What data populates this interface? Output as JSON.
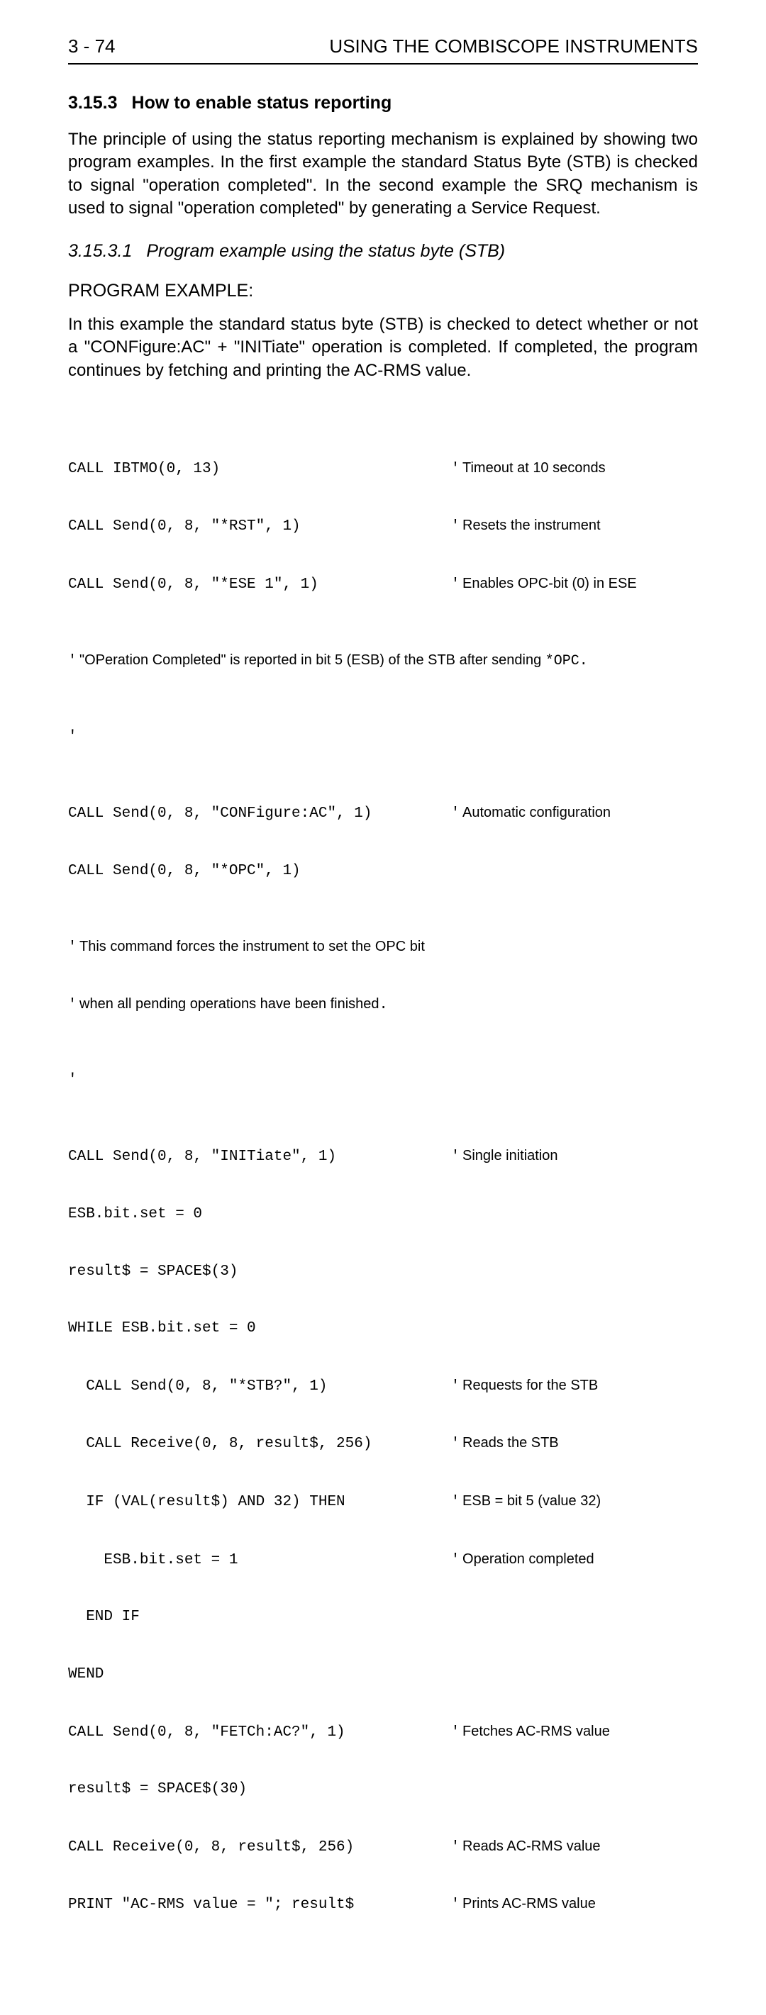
{
  "header": {
    "left": "3 - 74",
    "right": "USING THE COMBISCOPE INSTRUMENTS"
  },
  "section": {
    "number": "3.15.3",
    "title": "How to enable status reporting"
  },
  "para1": "The principle of using the status reporting mechanism is explained by showing two program examples. In the first example the standard Status Byte (STB) is checked to signal \"operation completed\". In the second example the SRQ mechanism is used to signal \"operation completed\" by generating a Service Request.",
  "subsection": {
    "number": "3.15.3.1",
    "title": "Program example using the status byte (STB)"
  },
  "programExampleLabel": "PROGRAM EXAMPLE:",
  "para2": "In this example the standard status byte (STB) is checked to detect whether or not a \"CONFigure:AC\" + \"INITiate\" operation is completed. If completed, the program continues by fetching and printing the AC-RMS value.",
  "code": {
    "l1": {
      "code": "CALL IBTMO(0, 13)",
      "comment": "Timeout at 10 seconds"
    },
    "l2": {
      "code": "CALL Send(0, 8, \"*RST\", 1)",
      "comment": "Resets the instrument"
    },
    "l3": {
      "code": "CALL Send(0, 8, \"*ESE 1\", 1)",
      "comment": "Enables OPC-bit (0) in ESE"
    },
    "l4": {
      "comment_pre": "\"OPeration Completed\" is reported in bit 5 (ESB) of the STB after sending ",
      "mono": "*OPC."
    },
    "l5": {
      "code": "'"
    },
    "l6": {
      "code": "CALL Send(0, 8, \"CONFigure:AC\", 1)",
      "comment": "Automatic configuration"
    },
    "l7": {
      "code": "CALL Send(0, 8, \"*OPC\", 1)"
    },
    "l8": {
      "comment": "This command forces the instrument to set the OPC bit"
    },
    "l9": {
      "comment_pre": "when all pending operations have been finished",
      "mono": "."
    },
    "l10": {
      "code": "'"
    },
    "l11": {
      "code": "CALL Send(0, 8, \"INITiate\", 1)",
      "comment": "Single initiation"
    },
    "l12": {
      "code": "ESB.bit.set = 0"
    },
    "l13": {
      "code": "result$ = SPACE$(3)"
    },
    "l14": {
      "code": "WHILE ESB.bit.set = 0"
    },
    "l15": {
      "code": "  CALL Send(0, 8, \"*STB?\", 1)",
      "comment": "Requests for the STB"
    },
    "l16": {
      "code": "  CALL Receive(0, 8, result$, 256)",
      "comment": "Reads the STB"
    },
    "l17": {
      "code": "  IF (VAL(result$) AND 32) THEN",
      "comment": "ESB = bit 5 (value 32)"
    },
    "l18": {
      "code": "    ESB.bit.set = 1",
      "comment": "Operation completed"
    },
    "l19": {
      "code": "  END IF"
    },
    "l20": {
      "code": "WEND"
    },
    "l21": {
      "code": "CALL Send(0, 8, \"FETCh:AC?\", 1)",
      "comment": "Fetches AC-RMS value"
    },
    "l22": {
      "code": "result$ = SPACE$(30)"
    },
    "l23": {
      "code": "CALL Receive(0, 8, result$, 256)",
      "comment": "Reads AC-RMS value"
    },
    "l24": {
      "code": "PRINT \"AC-RMS value = \"; result$",
      "comment": "Prints AC-RMS value"
    }
  }
}
